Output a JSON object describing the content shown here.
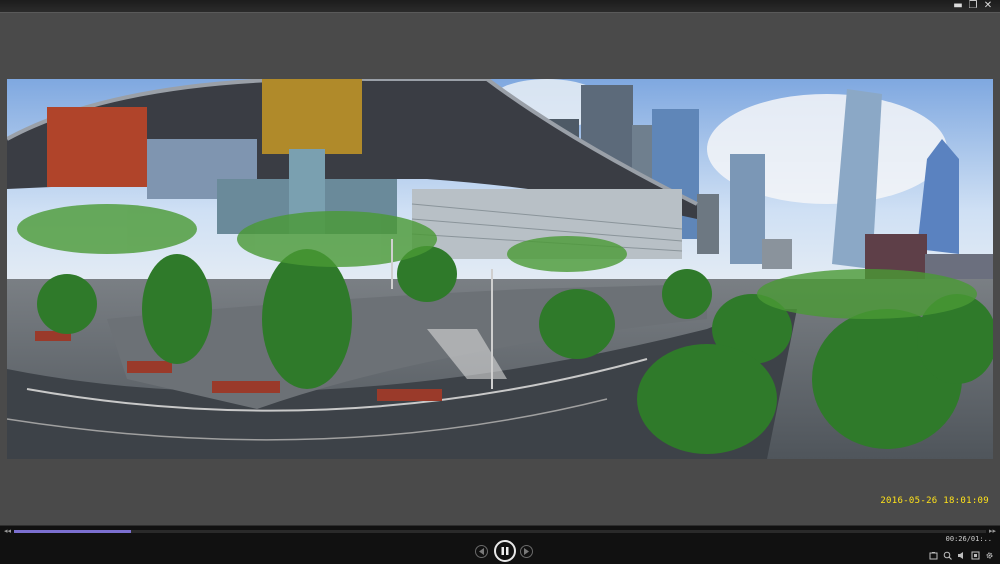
{
  "window": {
    "controls": [
      {
        "name": "minimize",
        "glyph": "▬"
      },
      {
        "name": "restore",
        "glyph": "❐"
      },
      {
        "name": "close",
        "glyph": "✕"
      }
    ]
  },
  "video": {
    "timestamp": "2016-05-26 18:01:09"
  },
  "player": {
    "progress": 0.12,
    "time": "00:26/01:..",
    "colors": {
      "accent": "#7b6fd0",
      "timestamp": "#ffe21a"
    },
    "buttons": [
      "previous-frame",
      "pause",
      "next-frame"
    ],
    "tools": [
      "snapshot-icon",
      "zoom-icon",
      "volume-icon",
      "fullscreen-icon",
      "settings-icon"
    ]
  }
}
